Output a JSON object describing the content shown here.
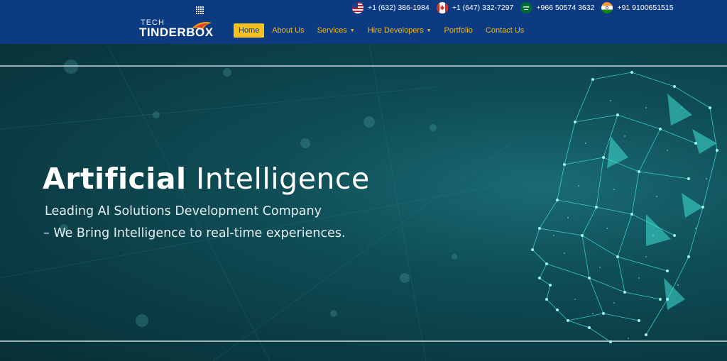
{
  "brand": {
    "line1": "TECH",
    "line2": "TINDERBOX"
  },
  "contacts": [
    {
      "flag": "us-flag-icon",
      "number": "+1 (632) 386-1984"
    },
    {
      "flag": "canada-flag-icon",
      "number": "+1 (647) 332-7297"
    },
    {
      "flag": "saudi-flag-icon",
      "number": "+966 50574 3632"
    },
    {
      "flag": "india-flag-icon",
      "number": "+91 9100651515"
    }
  ],
  "nav": {
    "home": "Home",
    "about": "About Us",
    "services": "Services",
    "hire": "Hire Developers",
    "portfolio": "Portfolio",
    "contact": "Contact Us"
  },
  "hero": {
    "title_bold": "Artificial",
    "title_light": "Intelligence",
    "subtitle_line1": "Leading AI Solutions Development Company",
    "subtitle_line2": " – We Bring Intelligence to real-time experiences."
  },
  "colors": {
    "header_bg": "#0c3b82",
    "nav_text": "#f0b81c",
    "nav_active_bg": "#f7c21d",
    "hero_bg": "#0f4e57",
    "accent_cyan": "#3fe0d4"
  }
}
